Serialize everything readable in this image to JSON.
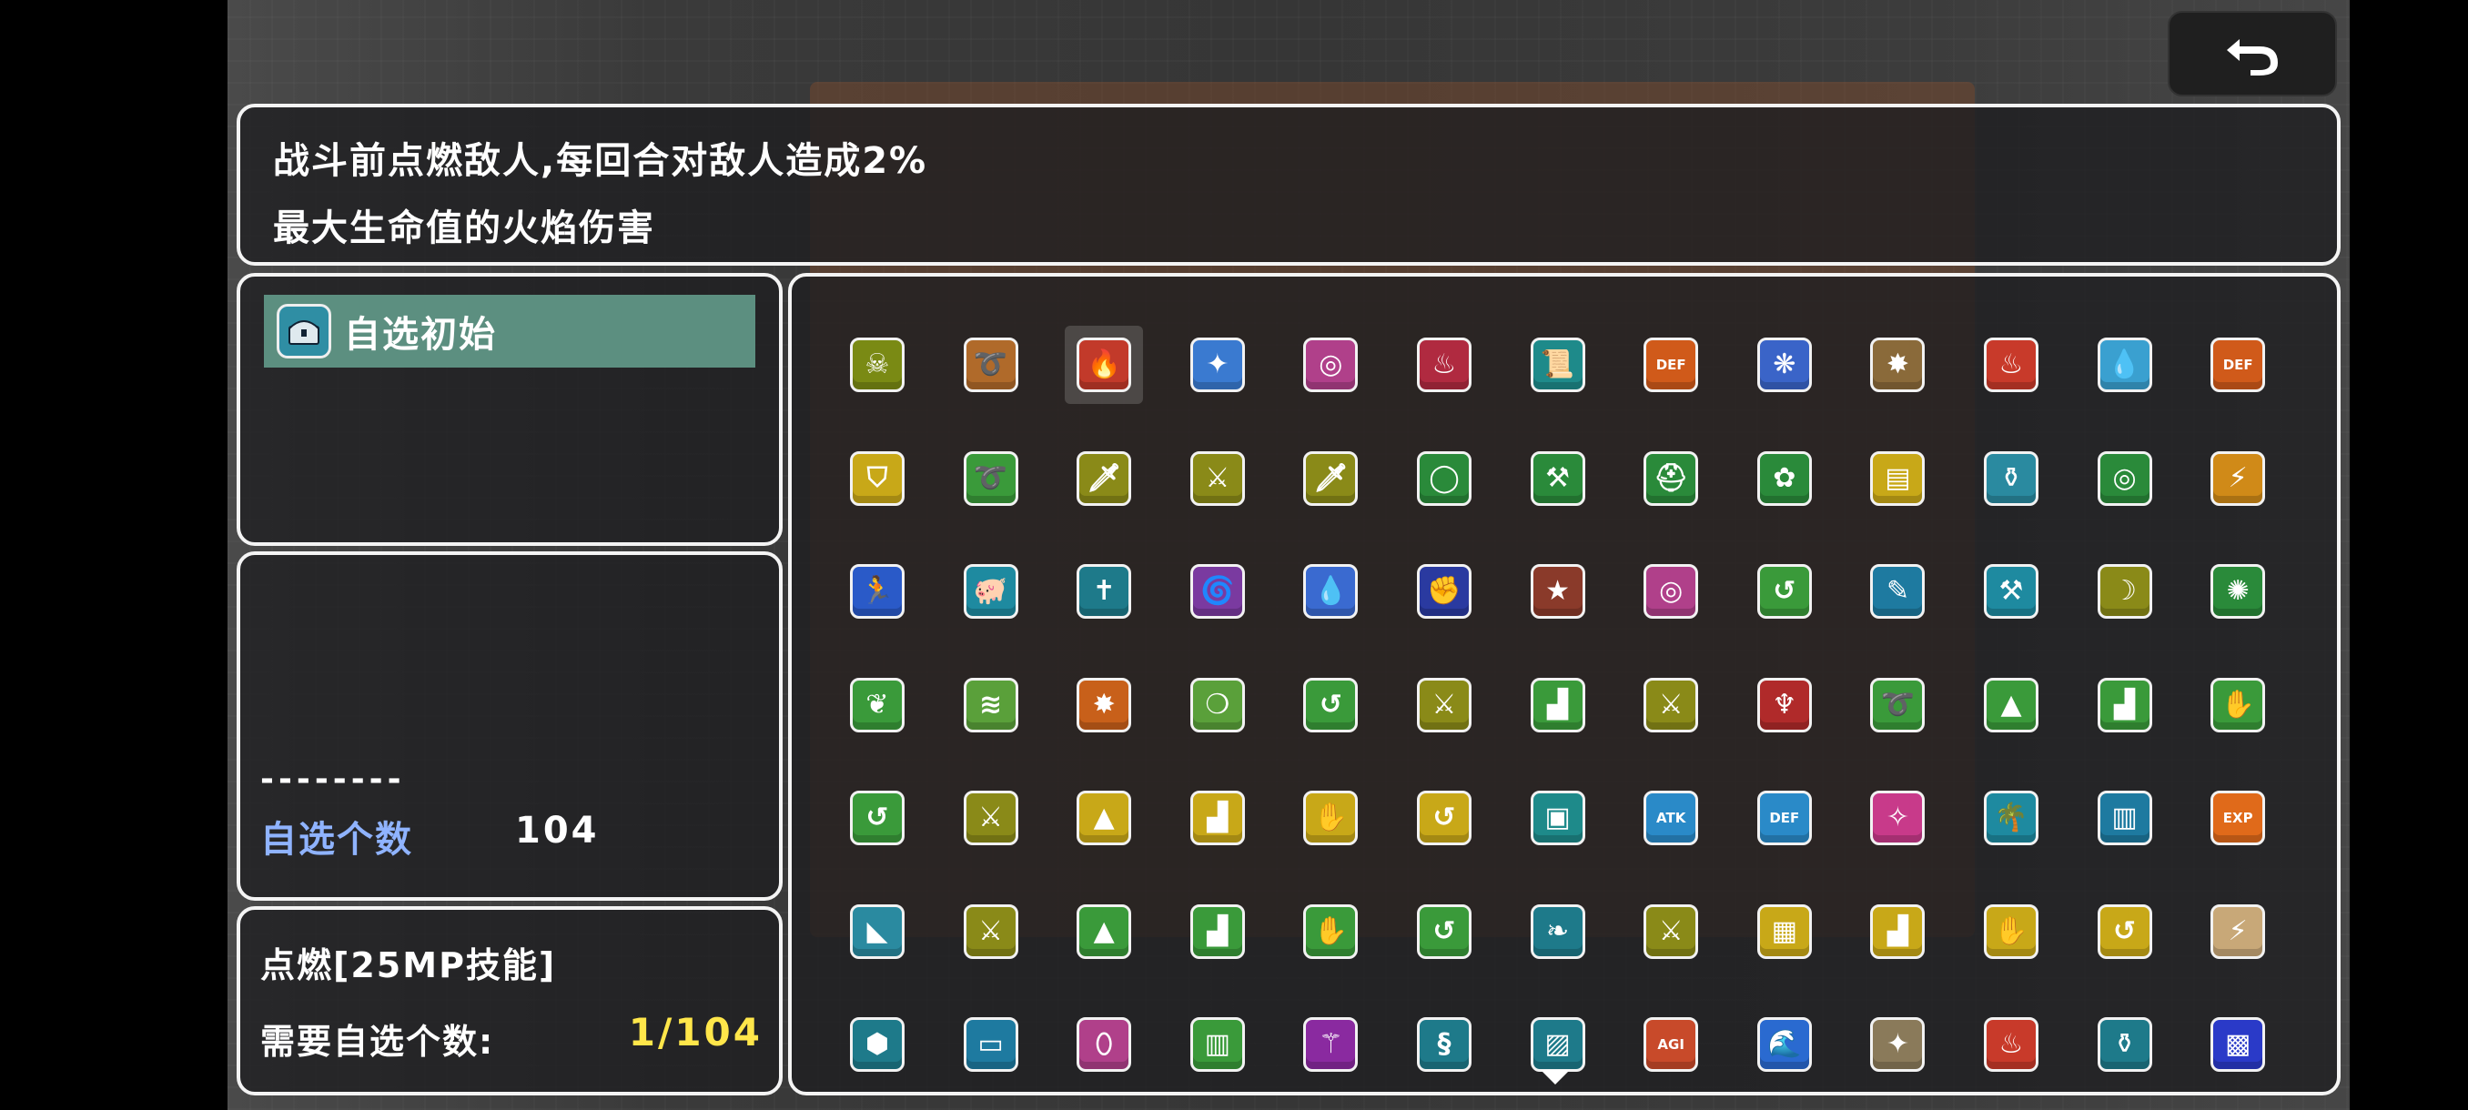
{
  "description": {
    "line1": "战斗前点燃敌人,每回合对敌人造成2%",
    "line2": "最大生命值的火焰伤害"
  },
  "category": {
    "label": "自选初始",
    "icon": "chest-icon"
  },
  "info": {
    "dashes": "--------",
    "count_label": "自选个数",
    "count_value": "104"
  },
  "skill": {
    "name": "点燃[25MP技能]",
    "need_label": "需要自选个数:",
    "need_value": "1/104"
  },
  "grid": {
    "rows": [
      [
        {
          "icon": "poison-drip-icon",
          "color": "#7a8a14",
          "glyph": "☠"
        },
        {
          "icon": "whip-icon",
          "color": "#b06a2a",
          "glyph": "➰"
        },
        {
          "icon": "fire-icon",
          "color": "#c23a2a",
          "glyph": "🔥",
          "selected": true
        },
        {
          "icon": "slash-icon",
          "color": "#3a7ad0",
          "glyph": "✦"
        },
        {
          "icon": "magic-circle-icon",
          "color": "#b0408a",
          "glyph": "◎"
        },
        {
          "icon": "fire-x2-icon",
          "color": "#b02a40",
          "glyph": "♨"
        },
        {
          "icon": "scroll-icon",
          "color": "#1e8a8a",
          "glyph": "📜"
        },
        {
          "icon": "def-up-icon",
          "color": "#d05a1a",
          "text": "DEF"
        },
        {
          "icon": "hex-shield-icon",
          "color": "#3a64c8",
          "glyph": "❋"
        },
        {
          "icon": "mace-icon",
          "color": "#8a6a3a",
          "glyph": "✸"
        },
        {
          "icon": "flame-icon",
          "color": "#c83a2a",
          "glyph": "♨"
        },
        {
          "icon": "water-drop-icon",
          "color": "#3aa0d0",
          "glyph": "💧"
        },
        {
          "icon": "def-up-icon",
          "color": "#d05a1a",
          "text": "DEF"
        }
      ],
      [
        {
          "icon": "shield-icon",
          "color": "#c8a818",
          "glyph": "⛉"
        },
        {
          "icon": "lasso-icon",
          "color": "#3a9a3a",
          "glyph": "➰"
        },
        {
          "icon": "dagger-icon",
          "color": "#8a8a18",
          "glyph": "🗡"
        },
        {
          "icon": "sword-icon",
          "color": "#8a8a18",
          "glyph": "⚔"
        },
        {
          "icon": "blade-icon",
          "color": "#8a8a18",
          "glyph": "🗡"
        },
        {
          "icon": "ring-icon",
          "color": "#2a8a3a",
          "glyph": "◯"
        },
        {
          "icon": "hammer-icon",
          "color": "#2a8a3a",
          "glyph": "⚒"
        },
        {
          "icon": "helmet-icon",
          "color": "#2a8a3a",
          "glyph": "⛑"
        },
        {
          "icon": "bow-tie-icon",
          "color": "#2a8a3a",
          "glyph": "✿"
        },
        {
          "icon": "book-icon",
          "color": "#c8a818",
          "glyph": "▤"
        },
        {
          "icon": "potion-jar-icon",
          "color": "#2a8aa0",
          "glyph": "⚱"
        },
        {
          "icon": "bracelet-icon",
          "color": "#2a8a3a",
          "glyph": "◎"
        },
        {
          "icon": "lightning-icon",
          "color": "#d08a18",
          "glyph": "⚡"
        }
      ],
      [
        {
          "icon": "running-man-icon",
          "color": "#2a5ac8",
          "glyph": "🏃"
        },
        {
          "icon": "piggy-bank-icon",
          "color": "#1e8aa0",
          "glyph": "🐖"
        },
        {
          "icon": "cross-icon",
          "color": "#1e7a8a",
          "glyph": "✝"
        },
        {
          "icon": "vortex-icon",
          "color": "#7a3aa0",
          "glyph": "🌀"
        },
        {
          "icon": "blood-drop-icon",
          "color": "#3a6ad0",
          "glyph": "💧"
        },
        {
          "icon": "gauntlet-icon",
          "color": "#2a3aa0",
          "glyph": "✊"
        },
        {
          "icon": "star-icon",
          "color": "#8a3a2a",
          "glyph": "★"
        },
        {
          "icon": "magic-circle-icon",
          "color": "#b0408a",
          "glyph": "◎"
        },
        {
          "icon": "hook-icon",
          "color": "#3a9a3a",
          "glyph": "↺"
        },
        {
          "icon": "bandage-icon",
          "color": "#1e7aa0",
          "glyph": "✎"
        },
        {
          "icon": "war-hammer-icon",
          "color": "#1e8aa0",
          "glyph": "⚒"
        },
        {
          "icon": "scythe-icon",
          "color": "#8a8a18",
          "glyph": "☽"
        },
        {
          "icon": "virus-icon",
          "color": "#2a8a3a",
          "glyph": "✺"
        }
      ],
      [
        {
          "icon": "herb-icon",
          "color": "#3a9a3a",
          "glyph": "❦"
        },
        {
          "icon": "tornado-icon",
          "color": "#5aa03a",
          "glyph": "≋"
        },
        {
          "icon": "explosion-icon",
          "color": "#c8601a",
          "glyph": "✸"
        },
        {
          "icon": "bubbles-icon",
          "color": "#5aa03a",
          "glyph": "❍"
        },
        {
          "icon": "hook-icon",
          "color": "#3a9a3a",
          "glyph": "↺"
        },
        {
          "icon": "sword-icon",
          "color": "#8a8a18",
          "glyph": "⚔"
        },
        {
          "icon": "boots-icon",
          "color": "#3a9a3a",
          "glyph": "▟"
        },
        {
          "icon": "sword-icon",
          "color": "#8a8a18",
          "glyph": "⚔"
        },
        {
          "icon": "demon-mask-icon",
          "color": "#b02a2a",
          "glyph": "♆"
        },
        {
          "icon": "lasso-icon",
          "color": "#3a9a3a",
          "glyph": "➰"
        },
        {
          "icon": "witch-hat-icon",
          "color": "#3a9a3a",
          "glyph": "▲"
        },
        {
          "icon": "boots-icon",
          "color": "#3a9a3a",
          "glyph": "▟"
        },
        {
          "icon": "glove-icon",
          "color": "#3a9a3a",
          "glyph": "✋"
        }
      ],
      [
        {
          "icon": "hook-icon",
          "color": "#3a9a3a",
          "glyph": "↺"
        },
        {
          "icon": "sword-icon",
          "color": "#8a8a18",
          "glyph": "⚔"
        },
        {
          "icon": "witch-hat-icon",
          "color": "#c8a818",
          "glyph": "▲"
        },
        {
          "icon": "boots-icon",
          "color": "#c8a818",
          "glyph": "▟"
        },
        {
          "icon": "glove-icon",
          "color": "#c8a818",
          "glyph": "✋"
        },
        {
          "icon": "hook-icon",
          "color": "#c8a818",
          "glyph": "↺"
        },
        {
          "icon": "armor-icon",
          "color": "#1e8a8a",
          "glyph": "▣"
        },
        {
          "icon": "atk-up-icon",
          "color": "#2a8ac8",
          "text": "ATK"
        },
        {
          "icon": "def-up-icon",
          "color": "#2a8ac8",
          "text": "DEF"
        },
        {
          "icon": "sparkle-icon",
          "color": "#c83a8a",
          "glyph": "✧"
        },
        {
          "icon": "palm-tree-icon",
          "color": "#1e8aa0",
          "glyph": "🌴"
        },
        {
          "icon": "spellbook-icon",
          "color": "#1e7aa0",
          "glyph": "▥"
        },
        {
          "icon": "exp-up-icon",
          "color": "#e06a1a",
          "text": "EXP"
        }
      ],
      [
        {
          "icon": "cliff-icon",
          "color": "#2a8aa0",
          "glyph": "◣"
        },
        {
          "icon": "sword-icon",
          "color": "#8a8a18",
          "glyph": "⚔"
        },
        {
          "icon": "witch-hat-icon",
          "color": "#3a9a3a",
          "glyph": "▲"
        },
        {
          "icon": "boots-icon",
          "color": "#3a9a3a",
          "glyph": "▟"
        },
        {
          "icon": "glove-icon",
          "color": "#3a9a3a",
          "glyph": "✋"
        },
        {
          "icon": "hook-icon",
          "color": "#3a9a3a",
          "glyph": "↺"
        },
        {
          "icon": "branch-icon",
          "color": "#1e7a8a",
          "glyph": "❧"
        },
        {
          "icon": "sword-icon",
          "color": "#8a8a18",
          "glyph": "⚔"
        },
        {
          "icon": "chainmail-icon",
          "color": "#c8a818",
          "glyph": "▦"
        },
        {
          "icon": "boots-icon",
          "color": "#c8a818",
          "glyph": "▟"
        },
        {
          "icon": "glove-icon",
          "color": "#c8a818",
          "glyph": "✋"
        },
        {
          "icon": "hook-icon",
          "color": "#c8a818",
          "glyph": "↺"
        },
        {
          "icon": "lightning-icon",
          "color": "#c8a878",
          "glyph": "⚡"
        }
      ],
      [
        {
          "icon": "gem-icon",
          "color": "#1e7a8a",
          "glyph": "⬢"
        },
        {
          "icon": "laptop-icon",
          "color": "#1e7aa0",
          "glyph": "▭"
        },
        {
          "icon": "eraser-icon",
          "color": "#b0408a",
          "glyph": "⬯"
        },
        {
          "icon": "open-book-icon",
          "color": "#3a9a3a",
          "glyph": "▥"
        },
        {
          "icon": "staff-icon",
          "color": "#8a2aa0",
          "glyph": "⚚"
        },
        {
          "icon": "cape-icon",
          "color": "#1e7a8a",
          "glyph": "§"
        },
        {
          "icon": "map-icon",
          "color": "#1e7a8a",
          "glyph": "▨"
        },
        {
          "icon": "agi-up-icon",
          "color": "#c84a2a",
          "text": "AGI"
        },
        {
          "icon": "wave-icon",
          "color": "#2a6ad0",
          "glyph": "🌊"
        },
        {
          "icon": "target-icon",
          "color": "#8a7a5a",
          "glyph": "✦"
        },
        {
          "icon": "flame-icon",
          "color": "#c83a2a",
          "glyph": "♨"
        },
        {
          "icon": "potion-jar-icon",
          "color": "#1e7a8a",
          "glyph": "⚱"
        },
        {
          "icon": "rune-icon",
          "color": "#2a3ac8",
          "glyph": "▩"
        }
      ]
    ]
  },
  "colors": {
    "panel_border": "#f4f4f4",
    "category_highlight": "#5c8f80",
    "count_label": "#8fb3ff",
    "need_value": "#ffe64a"
  },
  "back_button": {
    "icon": "undo-arrow-icon"
  }
}
